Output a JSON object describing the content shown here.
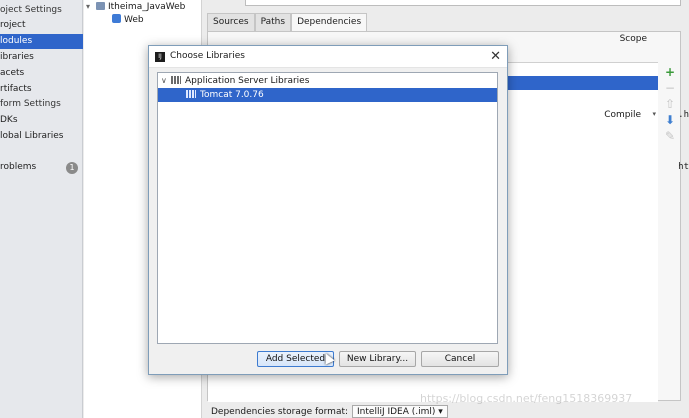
{
  "sidebar": {
    "items": [
      {
        "label": "oject Settings",
        "type": "section"
      },
      {
        "label": "roject",
        "type": "item"
      },
      {
        "label": "lodules",
        "type": "item",
        "selected": true
      },
      {
        "label": "ibraries",
        "type": "item"
      },
      {
        "label": "acets",
        "type": "item"
      },
      {
        "label": "rtifacts",
        "type": "item"
      },
      {
        "label": "form Settings",
        "type": "section"
      },
      {
        "label": "DKs",
        "type": "item"
      },
      {
        "label": "lobal Libraries",
        "type": "item"
      },
      {
        "label": "roblems",
        "type": "item",
        "badge": "1"
      }
    ]
  },
  "module_tree": {
    "root": "Itheima_JavaWeb",
    "child": "Web"
  },
  "tabs": [
    {
      "label": "Sources"
    },
    {
      "label": "Paths"
    },
    {
      "label": "Dependencies",
      "active": true
    }
  ],
  "dependencies": {
    "scope_header": "Scope",
    "scope_value": "Compile",
    "storage_label": "Dependencies storage format:",
    "storage_value": "IntelliJ IDEA (.iml)",
    "tool_add": "+",
    "tool_remove": "−",
    "tool_up": "⇧",
    "tool_down": "⬇",
    "tool_edit": "✎"
  },
  "background_text": {
    "line1": ".h",
    "line2": "ht"
  },
  "dialog": {
    "title": "Choose Libraries",
    "icon_label": "IJ",
    "close_glyph": "✕",
    "tree": {
      "group_label": "Application Server Libraries",
      "group_arrow": "∨",
      "selected_item": "Tomcat 7.0.76"
    },
    "buttons": {
      "add_selected": "Add Selected",
      "new_library": "New Library...",
      "cancel": "Cancel"
    }
  },
  "watermark": "https://blog.csdn.net/feng1518369937",
  "colors": {
    "selection": "#2f65ca",
    "add_icon": "#3a9a3a"
  }
}
